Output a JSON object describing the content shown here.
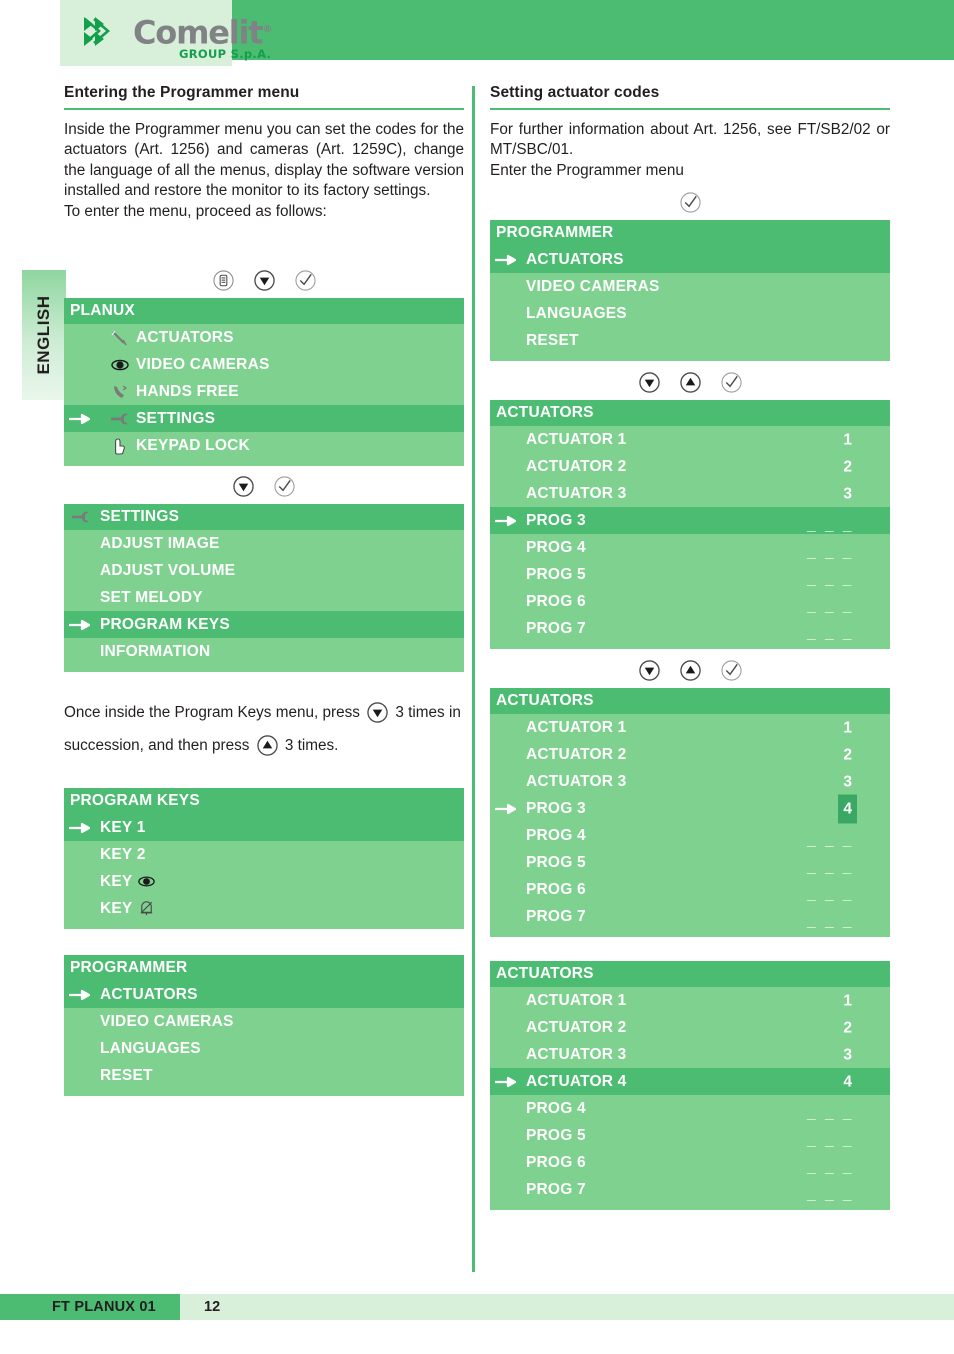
{
  "brand": {
    "name": "Comelit",
    "registered": "®",
    "subtitle": "GROUP S.p.A."
  },
  "language_tab": {
    "label": "ENGLISH"
  },
  "left_column": {
    "heading": "Entering the Programmer menu",
    "paragraph": "Inside the Programmer menu you can set the codes for the actuators (Art. 1256) and cameras (Art. 1259C), change the language of all the menus, display the software version installed and restore the monitor to its factory settings.",
    "paragraph2": "To enter the menu, proceed as follows:",
    "nav1": [
      "menu-icon",
      "down-arrow-icon",
      "confirm-icon"
    ],
    "menu_planux": {
      "title": "PLANUX",
      "rows": [
        {
          "label": "ACTUATORS",
          "icon": "key-icon",
          "selected": false
        },
        {
          "label": "VIDEO CAMERAS",
          "icon": "eye-icon",
          "selected": false
        },
        {
          "label": "HANDS FREE",
          "icon": "handset-icon",
          "selected": false
        },
        {
          "label": "SETTINGS",
          "icon": "wrench-icon",
          "selected": true
        },
        {
          "label": "KEYPAD LOCK",
          "icon": "hand-icon",
          "selected": false
        }
      ]
    },
    "nav2": [
      "down-arrow-icon",
      "confirm-icon"
    ],
    "menu_settings": {
      "title": "SETTINGS",
      "title_icon": "wrench-icon",
      "rows": [
        {
          "label": "ADJUST IMAGE",
          "selected": false
        },
        {
          "label": "ADJUST VOLUME",
          "selected": false
        },
        {
          "label": "SET MELODY",
          "selected": false
        },
        {
          "label": "PROGRAM KEYS",
          "selected": true
        },
        {
          "label": "INFORMATION",
          "selected": false
        }
      ]
    },
    "instruction_a": "Once inside the Program Keys menu, press",
    "instruction_b": "3",
    "instruction_c": "times in succession, and then press",
    "instruction_d": "3 times.",
    "menu_program_keys": {
      "title": "PROGRAM KEYS",
      "rows": [
        {
          "label": "KEY 1",
          "selected": true,
          "trailing_icon": ""
        },
        {
          "label": "KEY 2",
          "selected": false,
          "trailing_icon": ""
        },
        {
          "label": "KEY",
          "selected": false,
          "trailing_icon": "eye-icon"
        },
        {
          "label": "KEY",
          "selected": false,
          "trailing_icon": "bell-muted-icon"
        }
      ]
    },
    "menu_programmer": {
      "title": "PROGRAMMER",
      "rows": [
        {
          "label": "ACTUATORS",
          "selected": true
        },
        {
          "label": "VIDEO CAMERAS",
          "selected": false
        },
        {
          "label": "LANGUAGES",
          "selected": false
        },
        {
          "label": "RESET",
          "selected": false
        }
      ]
    }
  },
  "right_column": {
    "heading": "Setting actuator codes",
    "paragraph": "For further information about Art. 1256, see FT/SB2/02 or MT/SBC/01.",
    "paragraph2": "Enter the Programmer menu",
    "nav1": [
      "confirm-icon"
    ],
    "menu_programmer": {
      "title": "PROGRAMMER",
      "rows": [
        {
          "label": "ACTUATORS",
          "selected": true
        },
        {
          "label": "VIDEO CAMERAS",
          "selected": false
        },
        {
          "label": "LANGUAGES",
          "selected": false
        },
        {
          "label": "RESET",
          "selected": false
        }
      ]
    },
    "nav2": [
      "down-arrow-icon",
      "up-arrow-icon",
      "confirm-icon"
    ],
    "menu_actuators_1": {
      "title": "ACTUATORS",
      "rows": [
        {
          "label": "ACTUATOR 1",
          "value": "1",
          "selected": false,
          "boxed": false
        },
        {
          "label": "ACTUATOR 2",
          "value": "2",
          "selected": false,
          "boxed": false
        },
        {
          "label": "ACTUATOR 3",
          "value": "3",
          "selected": false,
          "boxed": false
        },
        {
          "label": "PROG 3",
          "value": "_ _ _",
          "selected": true,
          "boxed": false
        },
        {
          "label": "PROG 4",
          "value": "_ _ _",
          "selected": false,
          "boxed": false
        },
        {
          "label": "PROG 5",
          "value": "_ _ _",
          "selected": false,
          "boxed": false
        },
        {
          "label": "PROG 6",
          "value": "_ _ _",
          "selected": false,
          "boxed": false
        },
        {
          "label": "PROG 7",
          "value": "_ _ _",
          "selected": false,
          "boxed": false
        }
      ]
    },
    "nav3": [
      "down-arrow-icon",
      "up-arrow-icon",
      "confirm-icon"
    ],
    "menu_actuators_2": {
      "title": "ACTUATORS",
      "rows": [
        {
          "label": "ACTUATOR 1",
          "value": "1",
          "selected": false,
          "boxed": false
        },
        {
          "label": "ACTUATOR 2",
          "value": "2",
          "selected": false,
          "boxed": false
        },
        {
          "label": "ACTUATOR 3",
          "value": "3",
          "selected": false,
          "boxed": false
        },
        {
          "label": "PROG 3",
          "value": "4",
          "selected": false,
          "boxed": true
        },
        {
          "label": "PROG 4",
          "value": "_ _ _",
          "selected": false,
          "boxed": false
        },
        {
          "label": "PROG 5",
          "value": "_ _ _",
          "selected": false,
          "boxed": false
        },
        {
          "label": "PROG 6",
          "value": "_ _ _",
          "selected": false,
          "boxed": false
        },
        {
          "label": "PROG 7",
          "value": "_ _ _",
          "selected": false,
          "boxed": false
        }
      ]
    },
    "menu_actuators_3": {
      "title": "ACTUATORS",
      "rows": [
        {
          "label": "ACTUATOR 1",
          "value": "1",
          "selected": false,
          "boxed": false
        },
        {
          "label": "ACTUATOR 2",
          "value": "2",
          "selected": false,
          "boxed": false
        },
        {
          "label": "ACTUATOR 3",
          "value": "3",
          "selected": false,
          "boxed": false
        },
        {
          "label": "ACTUATOR 4",
          "value": "4",
          "selected": true,
          "boxed": false
        },
        {
          "label": "PROG 4",
          "value": "_ _ _",
          "selected": false,
          "boxed": false
        },
        {
          "label": "PROG 5",
          "value": "_ _ _",
          "selected": false,
          "boxed": false
        },
        {
          "label": "PROG 6",
          "value": "_ _ _",
          "selected": false,
          "boxed": false
        },
        {
          "label": "PROG 7",
          "value": "_ _ _",
          "selected": false,
          "boxed": false
        }
      ]
    }
  },
  "footer": {
    "document": "FT PLANUX 01",
    "page": "12"
  },
  "colors": {
    "header_green": "#4cbc72",
    "menu_body_green": "#7ed18f",
    "selected_green": "#4cbc72",
    "value_box_green": "#3aa862",
    "logo_box": "#d8f0d9",
    "logo_gray": "#808285",
    "logo_green": "#12a04a",
    "text": "#231f20"
  }
}
